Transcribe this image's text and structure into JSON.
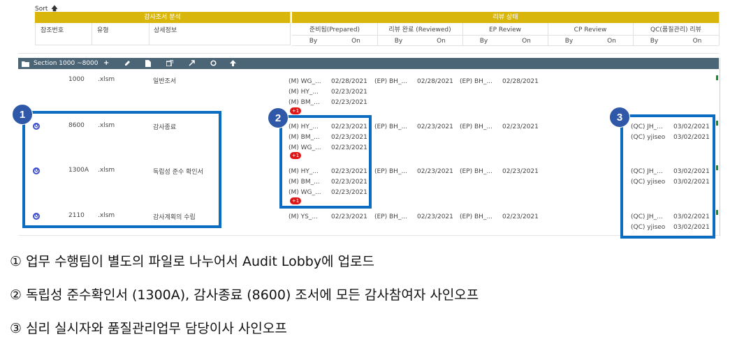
{
  "sort": {
    "label": "Sort",
    "arrow": "🡅"
  },
  "header_left": {
    "group_label": "감사조서 분석",
    "columns": [
      "참조번호",
      "유형",
      "상세정보"
    ]
  },
  "header_right": {
    "group_label": "리뷰 상태",
    "columns": [
      "준비됨(Prepared)",
      "리뷰 완료 (Reviewed)",
      "EP Review",
      "CP Review",
      "QC(품질관리) 리뷰"
    ],
    "sub": [
      "By",
      "On",
      "By",
      "On",
      "By",
      "On",
      "By",
      "On",
      "By",
      "On"
    ]
  },
  "section": {
    "title": "Section 1000 ~8000"
  },
  "rows": [
    {
      "ref": "1000",
      "type": ".xlsm",
      "detail": "일반조서",
      "has_q": false,
      "prepared": [
        [
          "(M) WG_...",
          "02/28/2021"
        ],
        [
          "(M) HY_...",
          "02/23/2021"
        ],
        [
          "(M) BM_...",
          "02/23/2021"
        ]
      ],
      "prepared_badge": "+1",
      "reviewed": [
        "(EP) BH_...",
        "02/28/2021"
      ],
      "ep": [
        "(EP) BH_...",
        "02/28/2021"
      ],
      "qc": []
    },
    {
      "ref": "8600",
      "type": ".xlsm",
      "detail": "감사종료",
      "has_q": true,
      "prepared": [
        [
          "(M) HY_...",
          "02/23/2021"
        ],
        [
          "(M) BM_...",
          "02/23/2021"
        ],
        [
          "(M) WG_...",
          "02/23/2021"
        ]
      ],
      "prepared_badge": "+1",
      "reviewed": [
        "(EP) BH_...",
        "02/23/2021"
      ],
      "ep": [
        "(EP) BH_...",
        "02/23/2021"
      ],
      "qc": [
        [
          "(QC) JH_...",
          "03/02/2021"
        ],
        [
          "(QC) yjiseo",
          "03/02/2021"
        ]
      ]
    },
    {
      "ref": "1300A",
      "type": ".xlsm",
      "detail": "독립성 준수 확인서",
      "has_q": true,
      "prepared": [
        [
          "(M) HY_...",
          "02/23/2021"
        ],
        [
          "(M) BM_...",
          "02/23/2021"
        ],
        [
          "(M) WG_...",
          "02/23/2021"
        ]
      ],
      "prepared_badge": "+1",
      "reviewed": [
        "(EP) BH_...",
        "02/23/2021"
      ],
      "ep": [
        "(EP) BH_...",
        "02/23/2021"
      ],
      "qc": [
        [
          "(QC) JH_...",
          "03/02/2021"
        ],
        [
          "(QC) yjiseo",
          "03/02/2021"
        ]
      ]
    },
    {
      "ref": "2110",
      "type": ".xlsm",
      "detail": "감사계획의 수립",
      "has_q": true,
      "prepared": [
        [
          "(M) YS_...",
          "02/23/2021"
        ]
      ],
      "prepared_badge": "",
      "reviewed": [
        "(EP) BH_...",
        "02/23/2021"
      ],
      "ep": [
        "(EP) BH_...",
        "02/23/2021"
      ],
      "qc": [
        [
          "(QC) JH_...",
          "03/02/2021"
        ],
        [
          "(QC) yjiseo",
          "03/02/2021"
        ]
      ]
    }
  ],
  "callouts": [
    "1",
    "2",
    "3"
  ],
  "notes": [
    "① 업무 수행팀이 별도의 파일로 나누어서 Audit Lobby에 업로드",
    "② 독립성 준수확인서 (1300A), 감사종료 (8600) 조서에 모든 감사참여자 사인오프",
    "③ 심리 실시자와 품질관리업무 담당이사 사인오프"
  ],
  "colors": {
    "gold": "#d9b60b",
    "section_bar": "#4b6476",
    "callout_border": "#0b6dc2",
    "callout_circle": "#2f59a8",
    "badge_red": "#e01414",
    "q_icon": "#3e4fd1"
  }
}
